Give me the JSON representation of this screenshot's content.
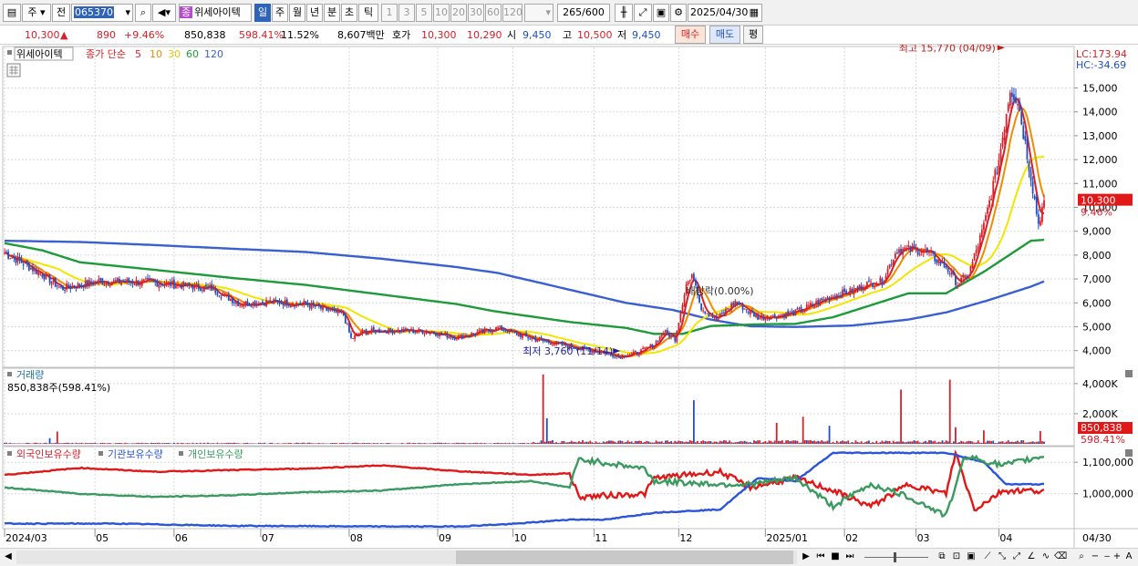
{
  "toolbar": {
    "market": "주",
    "prev_label": "전",
    "code": "065370",
    "name": "위세아이텍",
    "name_badge": "종",
    "periods": [
      "일",
      "주",
      "월",
      "년",
      "분",
      "초",
      "틱"
    ],
    "minute_options": [
      "1",
      "3",
      "5",
      "10",
      "20",
      "30",
      "60",
      "120"
    ],
    "count": "265",
    "count_total": "/600",
    "date": "2025/04/30"
  },
  "quote": {
    "price": "10,300",
    "change_mark": "▲",
    "change": "890",
    "change_pct": "+9.46%",
    "volume": "850,838",
    "volume_ratio": "598.41%",
    "turnover": "11.52%",
    "amount": "8,607백만",
    "ask_label": "호가",
    "ask": "10,300",
    "bid": "10,290",
    "open_label": "시",
    "open": "9,450",
    "high_label": "고",
    "high": "10,500",
    "low_label": "저",
    "low": "9,450",
    "buy_label": "매수",
    "sell_label": "매도",
    "avg_label": "평"
  },
  "colors": {
    "up": "#d8202a",
    "down": "#2050c0",
    "ma5": "#d8202a",
    "ma10": "#f08c00",
    "ma30": "#f2e600",
    "ma60": "#1e9a3a",
    "ma120": "#3a5fd0",
    "foreign": "#e01818",
    "inst": "#2a55d8",
    "indiv": "#3a9a60"
  },
  "chart_data": [
    {
      "type": "candlestick",
      "legend_name": "위세아이텍",
      "legend_ma_label": "종가 단순",
      "ma_periods": [
        "5",
        "10",
        "30",
        "60",
        "120"
      ],
      "ylim": [
        3300,
        16700
      ],
      "y_ticks": [
        "15,000",
        "14,000",
        "13,000",
        "12,000",
        "11,000",
        "10,000",
        "9,000",
        "8,000",
        "7,000",
        "6,000",
        "5,000",
        "4,000"
      ],
      "y_tick_values": [
        15000,
        14000,
        13000,
        12000,
        11000,
        10000,
        9000,
        8000,
        7000,
        6000,
        5000,
        4000
      ],
      "lc_label": "LC:173.94",
      "hc_label": "HC:-34.69",
      "last_price_label": "10,300",
      "last_pct_label": "9.46%",
      "max_label": "최고 15,770 (04/09)",
      "min_label": "최저 3,760 (11/14)",
      "event_label": "배당락(0.00%)",
      "x_tick_labels": [
        "2024/03",
        "05",
        "06",
        "07",
        "08",
        "09",
        "10",
        "11",
        "12",
        "2025/01",
        "02",
        "03",
        "04",
        "04/30"
      ],
      "series_points": [
        {
          "name": "ma120",
          "points": [
            [
              0,
              8600
            ],
            [
              40,
              8550
            ],
            [
              80,
              8420
            ],
            [
              120,
              8270
            ],
            [
              160,
              8130
            ],
            [
              200,
              7850
            ],
            [
              240,
              7500
            ],
            [
              262,
              7250
            ],
            [
              300,
              6550
            ],
            [
              330,
              6000
            ],
            [
              355,
              5700
            ],
            [
              375,
              5300
            ],
            [
              396,
              5020
            ],
            [
              420,
              4990
            ],
            [
              450,
              5050
            ],
            [
              480,
              5300
            ],
            [
              500,
              5600
            ],
            [
              522,
              6100
            ],
            [
              545,
              6680
            ],
            [
              552,
              6900
            ]
          ]
        },
        {
          "name": "ma60",
          "points": [
            [
              0,
              8500
            ],
            [
              20,
              8200
            ],
            [
              40,
              7700
            ],
            [
              80,
              7380
            ],
            [
              120,
              7050
            ],
            [
              160,
              6750
            ],
            [
              200,
              6350
            ],
            [
              240,
              5950
            ],
            [
              260,
              5650
            ],
            [
              300,
              5200
            ],
            [
              330,
              4950
            ],
            [
              345,
              4700
            ],
            [
              360,
              4700
            ],
            [
              375,
              5030
            ],
            [
              400,
              5100
            ],
            [
              420,
              5120
            ],
            [
              440,
              5400
            ],
            [
              460,
              5900
            ],
            [
              480,
              6400
            ],
            [
              500,
              6400
            ],
            [
              520,
              7300
            ],
            [
              545,
              8600
            ],
            [
              552,
              8640
            ]
          ]
        }
      ],
      "candles_summary": "265 daily candles 2024/03 - 2025/04/30"
    },
    {
      "type": "bar",
      "title": "거래량",
      "value_label": "850,838주(598.41%)",
      "y_ticks": [
        "4,000K",
        "2,000K"
      ],
      "ylim": [
        0,
        4900000
      ],
      "last_label": "850,838",
      "last_pct": "598.41%",
      "spikes": [
        [
          24,
          380000
        ],
        [
          28,
          820000
        ],
        [
          286,
          4600000
        ],
        [
          288,
          1700000
        ],
        [
          366,
          2900000
        ],
        [
          410,
          1400000
        ],
        [
          424,
          1800000
        ],
        [
          438,
          1200000
        ],
        [
          476,
          3600000
        ],
        [
          502,
          4260000
        ],
        [
          505,
          1100000
        ],
        [
          520,
          900000
        ],
        [
          550,
          850838
        ]
      ]
    },
    {
      "type": "line",
      "legend": [
        "외국인보유수량",
        "기관보유수량",
        "개인보유수량"
      ],
      "y_ticks": [
        "1,100,000",
        "1,000,000"
      ],
      "ylim": [
        892000,
        1144000
      ],
      "series": [
        {
          "name": "외국인보유수량",
          "points": [
            [
              0,
              1060000
            ],
            [
              40,
              1082000
            ],
            [
              80,
              1070000
            ],
            [
              120,
              1075000
            ],
            [
              160,
              1080000
            ],
            [
              200,
              1090000
            ],
            [
              240,
              1072000
            ],
            [
              280,
              1060000
            ],
            [
              300,
              1065000
            ],
            [
              305,
              990000
            ],
            [
              340,
              1000000
            ],
            [
              345,
              1050000
            ],
            [
              380,
              1070000
            ],
            [
              396,
              1020000
            ],
            [
              420,
              1050000
            ],
            [
              440,
              1010000
            ],
            [
              460,
              960000
            ],
            [
              480,
              1030000
            ],
            [
              500,
              1000000
            ],
            [
              505,
              1130000
            ],
            [
              515,
              950000
            ],
            [
              530,
              1010000
            ],
            [
              552,
              1010000
            ]
          ]
        },
        {
          "name": "기관보유수량",
          "points": [
            [
              0,
              905000
            ],
            [
              60,
              905000
            ],
            [
              120,
              898000
            ],
            [
              200,
              896000
            ],
            [
              240,
              896000
            ],
            [
              270,
              904000
            ],
            [
              300,
              918000
            ],
            [
              320,
              918000
            ],
            [
              345,
              940000
            ],
            [
              380,
              950000
            ],
            [
              400,
              1050000
            ],
            [
              420,
              1040000
            ],
            [
              440,
              1130000
            ],
            [
              500,
              1130000
            ],
            [
              520,
              1100000
            ],
            [
              532,
              1030000
            ],
            [
              552,
              1030000
            ]
          ]
        },
        {
          "name": "개인보유수량",
          "points": [
            [
              0,
              1020000
            ],
            [
              40,
              1000000
            ],
            [
              80,
              990000
            ],
            [
              120,
              995000
            ],
            [
              160,
              1005000
            ],
            [
              200,
              1010000
            ],
            [
              240,
              1030000
            ],
            [
              280,
              1040000
            ],
            [
              300,
              1020000
            ],
            [
              305,
              1110000
            ],
            [
              340,
              1080000
            ],
            [
              345,
              1040000
            ],
            [
              380,
              1030000
            ],
            [
              396,
              1030000
            ],
            [
              420,
              1050000
            ],
            [
              440,
              960000
            ],
            [
              460,
              1030000
            ],
            [
              480,
              990000
            ],
            [
              500,
              930000
            ],
            [
              510,
              1120000
            ],
            [
              530,
              1090000
            ],
            [
              552,
              1120000
            ]
          ]
        }
      ]
    }
  ],
  "scroll": {
    "left_arrow": "◀",
    "right_arrow": "▶"
  }
}
